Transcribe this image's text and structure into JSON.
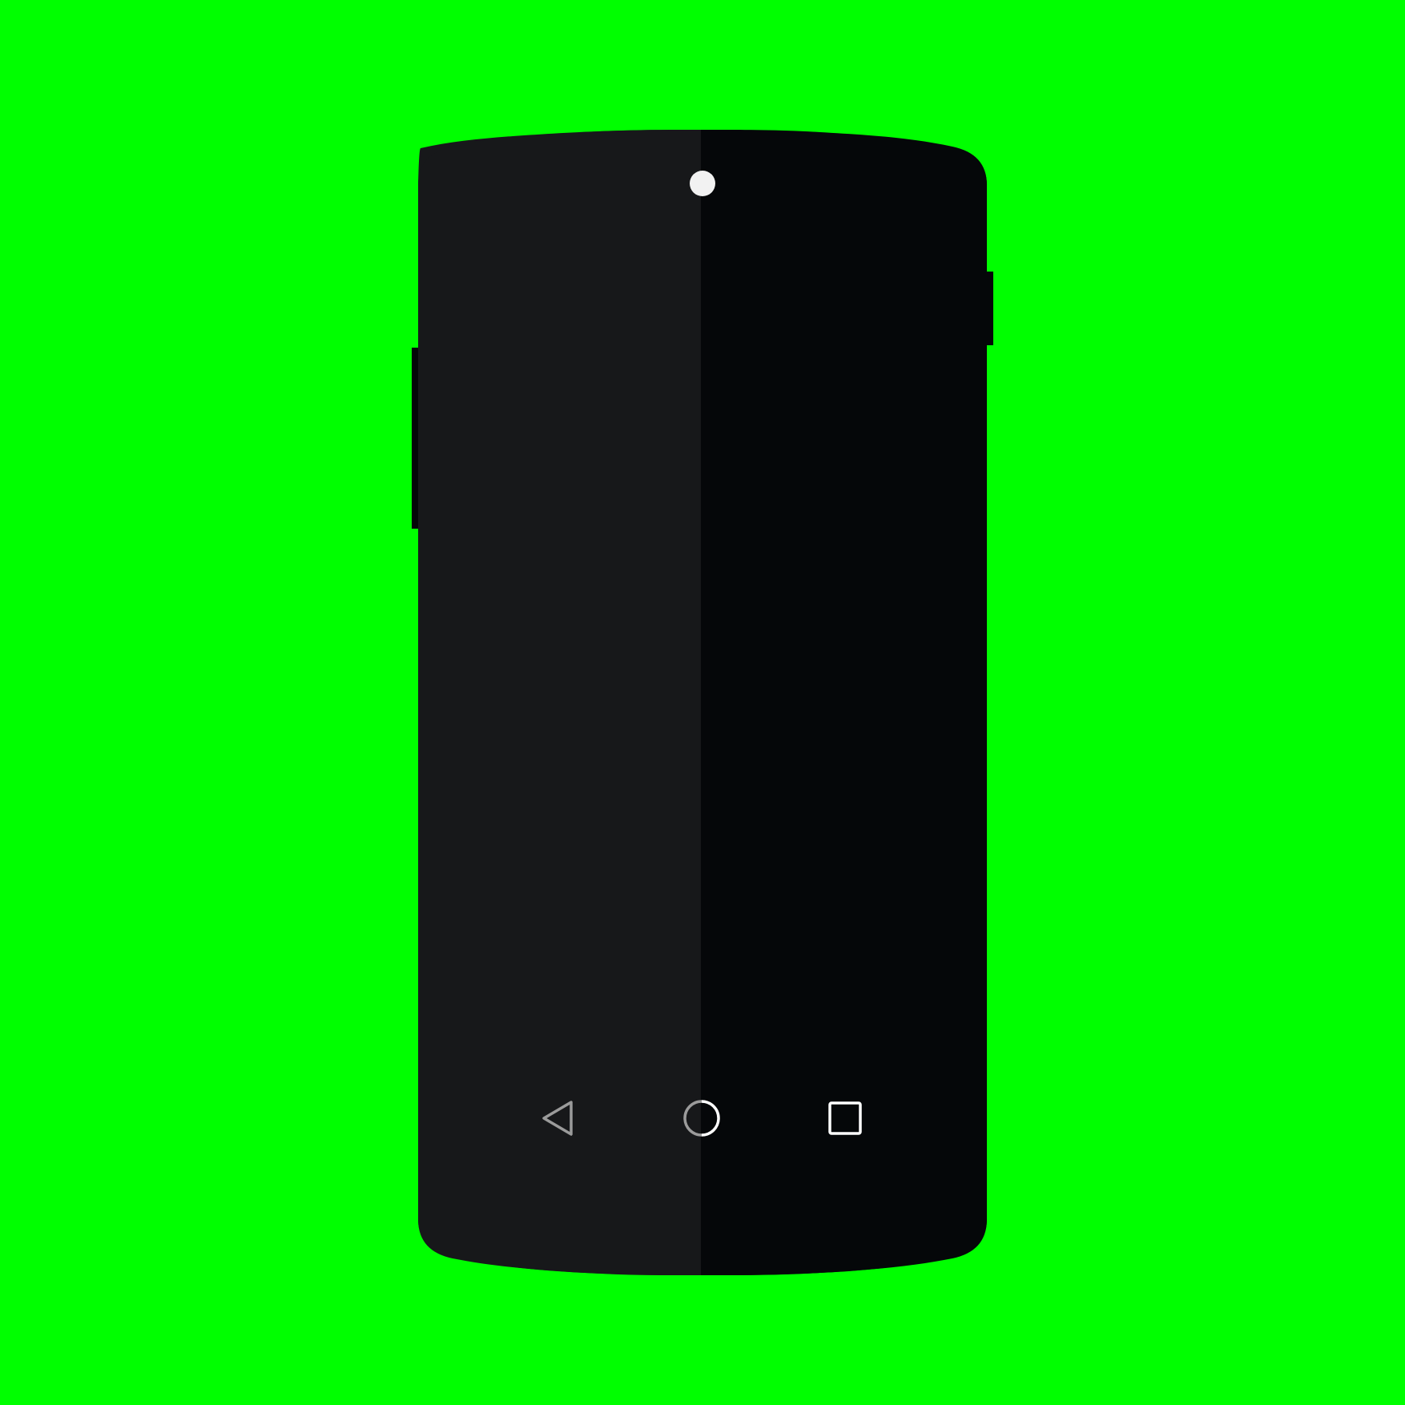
{
  "colors": {
    "background": "#00ff00",
    "body_left": "#17181a",
    "body_right": "#050709",
    "side_buttons": "#050709",
    "camera": "#f2f2f2",
    "nav_left_stroke": "#9b9b9b",
    "nav_right_stroke": "#ffffff"
  },
  "device": {
    "front_camera": "camera-icon",
    "side_buttons": [
      "power-button",
      "volume-rocker"
    ]
  },
  "nav_bar": {
    "buttons": [
      {
        "name": "back-button",
        "icon": "back-triangle-icon"
      },
      {
        "name": "home-button",
        "icon": "home-circle-icon"
      },
      {
        "name": "recents-button",
        "icon": "recents-square-icon"
      }
    ]
  }
}
